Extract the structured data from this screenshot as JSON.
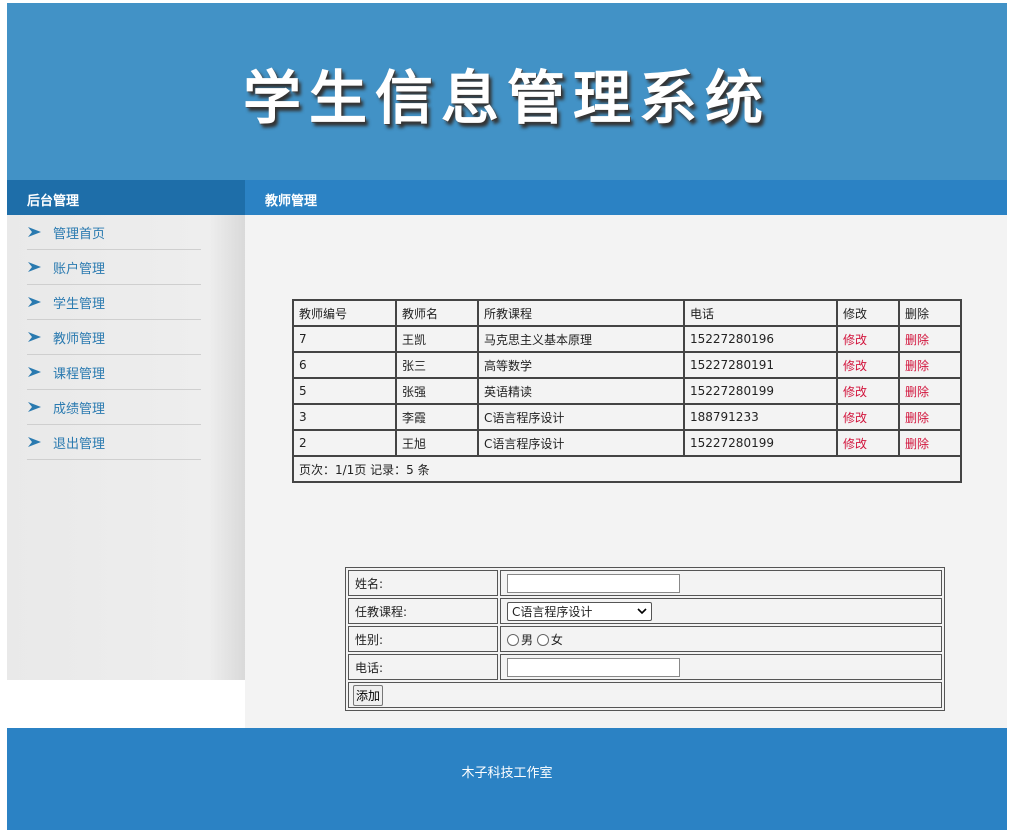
{
  "header": {
    "title": "学生信息管理系统"
  },
  "sidebar": {
    "heading": "后台管理",
    "items": [
      {
        "label": "管理首页"
      },
      {
        "label": "账户管理"
      },
      {
        "label": "学生管理"
      },
      {
        "label": "教师管理"
      },
      {
        "label": "课程管理"
      },
      {
        "label": "成绩管理"
      },
      {
        "label": "退出管理"
      }
    ]
  },
  "main": {
    "heading": "教师管理",
    "table": {
      "columns": [
        "教师编号",
        "教师名",
        "所教课程",
        "电话",
        "修改",
        "删除"
      ],
      "rows": [
        {
          "id": "7",
          "name": "王凯",
          "course": "马克思主义基本原理",
          "phone": "15227280196",
          "edit": "修改",
          "delete": "删除"
        },
        {
          "id": "6",
          "name": "张三",
          "course": "高等数学",
          "phone": "15227280191",
          "edit": "修改",
          "delete": "删除"
        },
        {
          "id": "5",
          "name": "张强",
          "course": "英语精读",
          "phone": "15227280199",
          "edit": "修改",
          "delete": "删除"
        },
        {
          "id": "3",
          "name": "李霞",
          "course": "C语言程序设计",
          "phone": "188791233",
          "edit": "修改",
          "delete": "删除"
        },
        {
          "id": "2",
          "name": "王旭",
          "course": "C语言程序设计",
          "phone": "15227280199",
          "edit": "修改",
          "delete": "删除"
        }
      ],
      "pagination": "页次：1/1页 记录：5 条"
    },
    "form": {
      "name_label": "姓名:",
      "name_value": "",
      "course_label": "任教课程:",
      "course_selected": "C语言程序设计",
      "gender_label": "性别:",
      "gender_male": "男",
      "gender_female": "女",
      "phone_label": "电话:",
      "phone_value": "",
      "add_button": "添加"
    }
  },
  "footer": {
    "text": "木子科技工作室"
  },
  "colors": {
    "header": "#4292c6",
    "bar": "#2b82c4",
    "link": "#2a7ab0",
    "action": "#d2143c"
  }
}
